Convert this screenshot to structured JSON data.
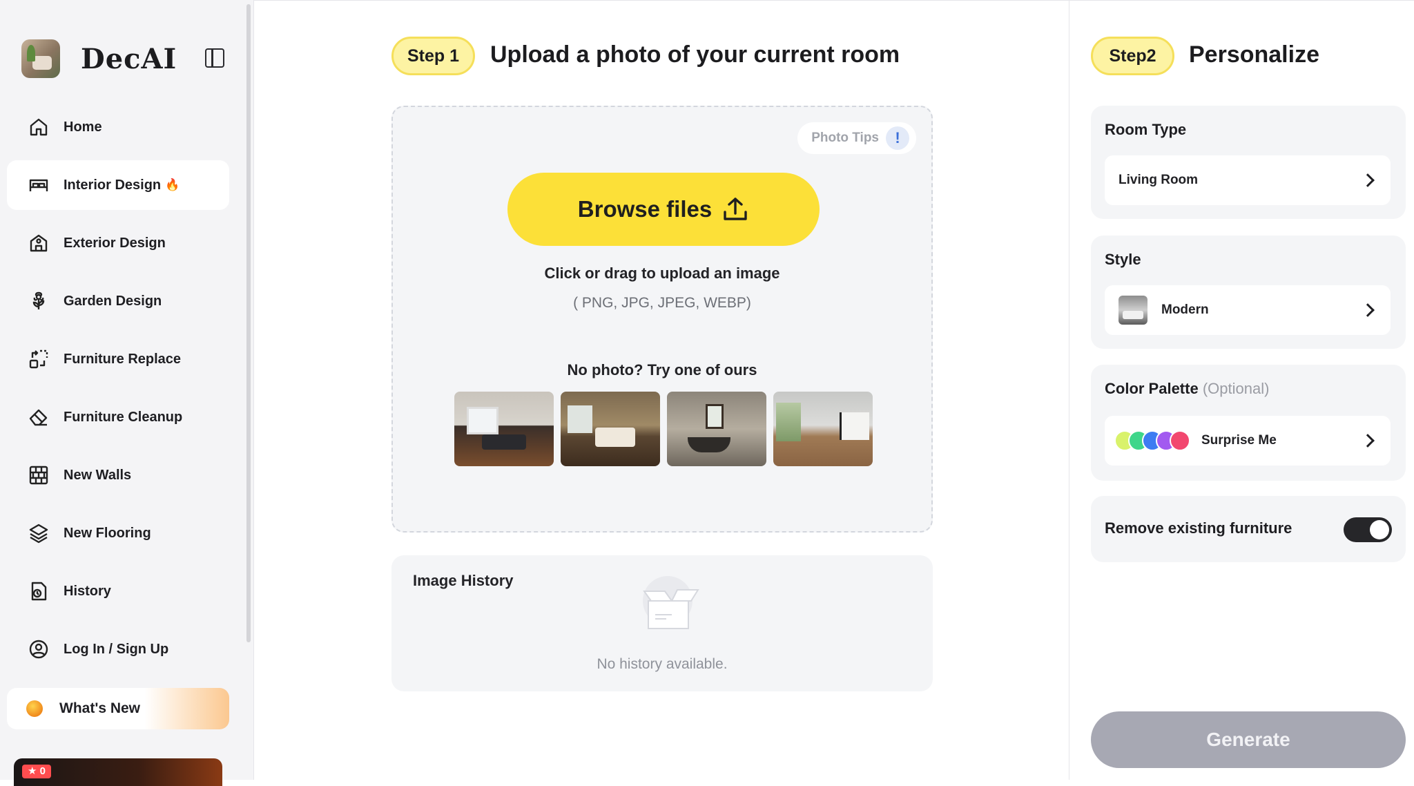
{
  "brand": {
    "name": "DecAI"
  },
  "nav": [
    {
      "label": "Home",
      "icon": "home-icon",
      "active": false
    },
    {
      "label": "Interior Design",
      "icon": "bed-icon",
      "active": true,
      "badge": "🔥"
    },
    {
      "label": "Exterior Design",
      "icon": "building-icon",
      "active": false
    },
    {
      "label": "Garden Design",
      "icon": "flower-icon",
      "active": false
    },
    {
      "label": "Furniture Replace",
      "icon": "replace-icon",
      "active": false
    },
    {
      "label": "Furniture Cleanup",
      "icon": "eraser-icon",
      "active": false
    },
    {
      "label": "New Walls",
      "icon": "wall-icon",
      "active": false
    },
    {
      "label": "New Flooring",
      "icon": "layers-icon",
      "active": false
    },
    {
      "label": "History",
      "icon": "history-icon",
      "active": false
    },
    {
      "label": "Log In / Sign Up",
      "icon": "user-icon",
      "active": false
    }
  ],
  "whats_new": {
    "label": "What's New"
  },
  "promo": {
    "badge": "★ 0"
  },
  "step1": {
    "pill": "Step 1",
    "title": "Upload a photo of your current room",
    "photo_tips": "Photo Tips",
    "photo_tips_icon": "!",
    "browse_label": "Browse files",
    "hint": "Click or drag to upload an image",
    "formats": "( PNG, JPG, JPEG, WEBP)",
    "samples_title": "No photo? Try one of ours"
  },
  "history": {
    "title": "Image History",
    "empty": "No history available."
  },
  "step2": {
    "pill": "Step2",
    "title": "Personalize",
    "room_type": {
      "title": "Room Type",
      "value": "Living Room"
    },
    "style": {
      "title": "Style",
      "value": "Modern"
    },
    "color_palette": {
      "title": "Color Palette",
      "optional": "(Optional)",
      "value": "Surprise Me",
      "swatch_colors": [
        "#d9f26b",
        "#3fd68a",
        "#3d7cf2",
        "#a25af0",
        "#f2476f"
      ]
    },
    "remove_furniture": {
      "label": "Remove existing furniture",
      "enabled": true
    },
    "generate_label": "Generate"
  },
  "colors": {
    "accent_yellow": "#fce038",
    "pill_fill": "#fdf3a3",
    "generate_disabled": "#a7a8b3"
  }
}
